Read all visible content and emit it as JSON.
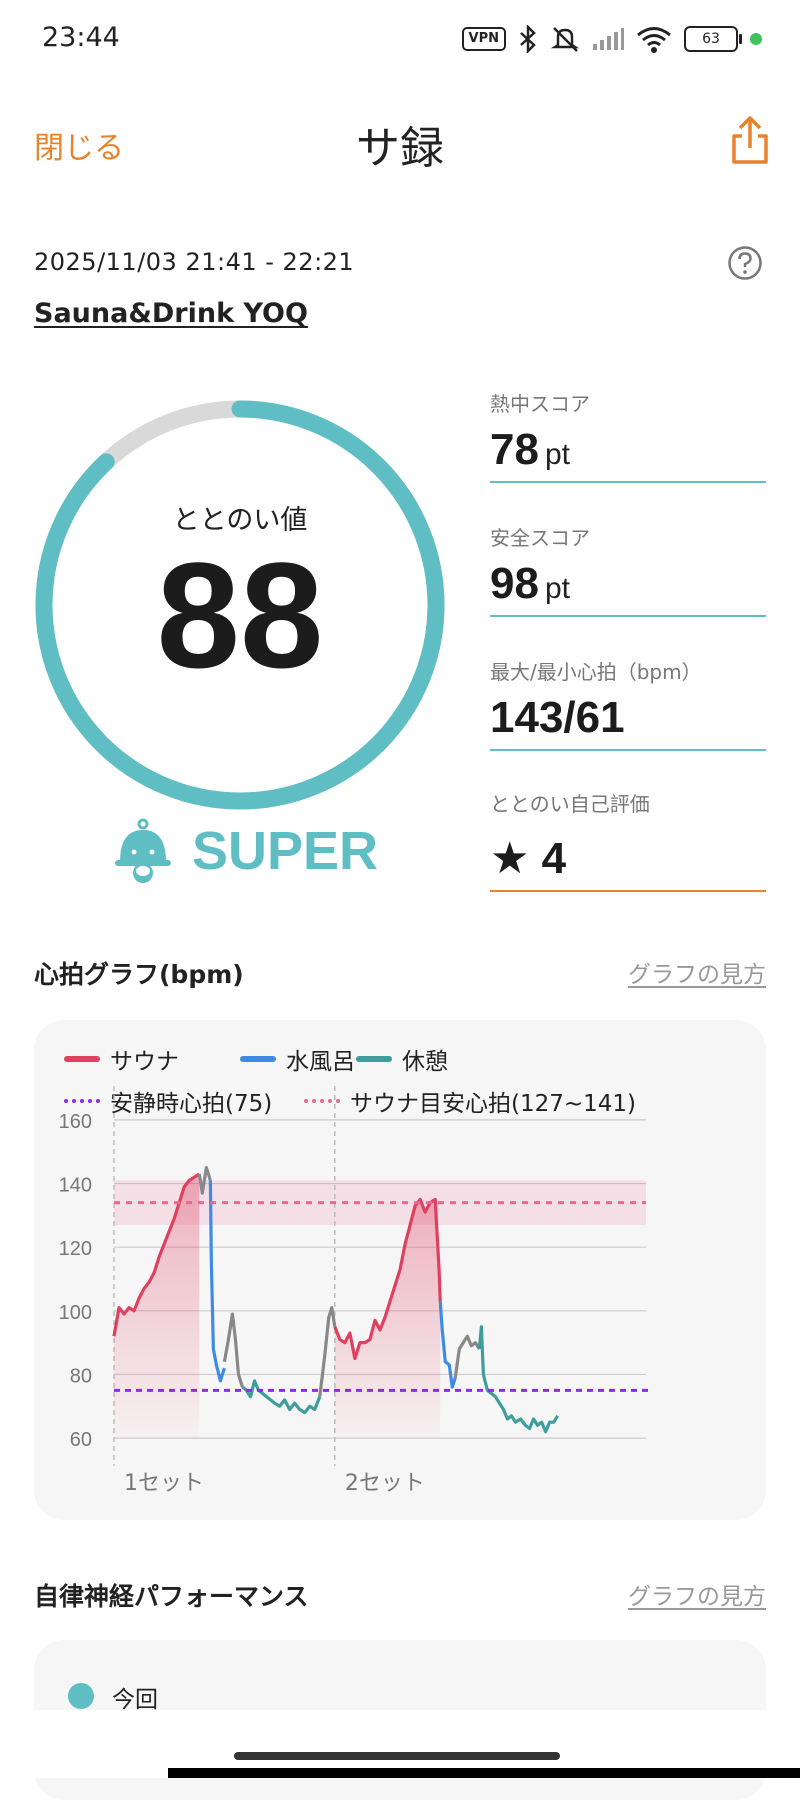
{
  "status_bar": {
    "time": "23:44",
    "vpn": "VPN",
    "battery": "63",
    "icons": [
      "vpn-icon",
      "bluetooth-icon",
      "mute-icon",
      "signal-icon",
      "wifi-icon",
      "battery-icon",
      "active-dot"
    ]
  },
  "header": {
    "close_label": "閉じる",
    "title": "サ録",
    "share_icon": "share-icon"
  },
  "session": {
    "time_range": "2025/11/03 21:41 - 22:21",
    "facility": "Sauna&Drink YOQ",
    "help_icon": "help-icon"
  },
  "score": {
    "label": "ととのい値",
    "value": "88",
    "progress": 0.88,
    "grade": "SUPER",
    "grade_icon": "bell-character-icon"
  },
  "metrics": [
    {
      "label": "熱中スコア",
      "value": "78",
      "unit": "pt"
    },
    {
      "label": "安全スコア",
      "value": "98",
      "unit": "pt"
    },
    {
      "label": "最大/最小心拍（bpm）",
      "value": "143/61",
      "unit": ""
    },
    {
      "label": "ととのい自己評価",
      "value": "★ 4",
      "unit": ""
    }
  ],
  "heart_section": {
    "title": "心拍グラフ(bpm)",
    "link": "グラフの見方"
  },
  "autonomic_section": {
    "title": "自律神経パフォーマンス",
    "link": "グラフの見方",
    "legend_label": "今回"
  },
  "colors": {
    "accent": "#5fbec3",
    "orange": "#e8822b",
    "sauna": "#e0405f",
    "water": "#3d8be6",
    "rest": "#3f9e9c",
    "resting_hr": "#8b2be2",
    "target_hr": "#e8698f",
    "transition": "#888888"
  },
  "chart_data": {
    "type": "line",
    "ylim": [
      55,
      165
    ],
    "yticks": [
      60,
      80,
      100,
      120,
      140,
      160
    ],
    "legend": [
      "サウナ",
      "水風呂",
      "休憩",
      "安静時心拍(75)",
      "サウナ目安心拍(127~141)"
    ],
    "resting_hr": 75,
    "target_band": [
      127,
      141
    ],
    "target_line": 134,
    "set_labels": [
      "1セット",
      "2セット"
    ],
    "set_starts": [
      0,
      220
    ],
    "x_max": 530,
    "series": [
      {
        "name": "サウナ",
        "segments": [
          [
            [
              0,
              92
            ],
            [
              5,
              101
            ],
            [
              10,
              99
            ],
            [
              15,
              101
            ],
            [
              20,
              100
            ],
            [
              25,
              104
            ],
            [
              30,
              107
            ],
            [
              35,
              109
            ],
            [
              40,
              112
            ],
            [
              45,
              117
            ],
            [
              50,
              121
            ],
            [
              55,
              125
            ],
            [
              60,
              129
            ],
            [
              65,
              134
            ],
            [
              70,
              139
            ],
            [
              75,
              141
            ],
            [
              80,
              142
            ],
            [
              85,
              143
            ]
          ]
        ]
      },
      {
        "name": "",
        "segments": [
          [
            [
              85,
              143
            ],
            [
              88,
              137
            ],
            [
              92,
              145
            ],
            [
              96,
              141
            ]
          ],
          [
            [
              110,
              84
            ],
            [
              114,
              91
            ],
            [
              118,
              99
            ],
            [
              121,
              91
            ],
            [
              124,
              80
            ],
            [
              128,
              76
            ]
          ],
          [
            [
              205,
              73
            ],
            [
              210,
              86
            ],
            [
              214,
              98
            ],
            [
              217,
              101
            ],
            [
              220,
              95
            ]
          ],
          [
            [
              340,
              79
            ],
            [
              344,
              88
            ],
            [
              348,
              90
            ],
            [
              352,
              92
            ],
            [
              356,
              89
            ],
            [
              360,
              90
            ],
            [
              364,
              88
            ]
          ]
        ]
      },
      {
        "name": "水風呂",
        "segments": [
          [
            [
              96,
              141
            ],
            [
              97,
              115
            ],
            [
              99,
              88
            ],
            [
              102,
              83
            ],
            [
              106,
              78
            ],
            [
              110,
              82
            ]
          ],
          [
            [
              325,
              103
            ],
            [
              327,
              94
            ],
            [
              330,
              84
            ],
            [
              334,
              83
            ],
            [
              337,
              76
            ],
            [
              340,
              79
            ]
          ]
        ]
      },
      {
        "name": "休憩",
        "segments": [
          [
            [
              128,
              76
            ],
            [
              132,
              75
            ],
            [
              136,
              73
            ],
            [
              140,
              78
            ],
            [
              144,
              75
            ],
            [
              148,
              74
            ],
            [
              152,
              73
            ],
            [
              156,
              72
            ],
            [
              160,
              71
            ],
            [
              165,
              70
            ],
            [
              170,
              72
            ],
            [
              175,
              69
            ],
            [
              180,
              71
            ],
            [
              185,
              69
            ],
            [
              190,
              68
            ],
            [
              195,
              70
            ],
            [
              200,
              69
            ],
            [
              205,
              73
            ]
          ],
          [
            [
              364,
              88
            ],
            [
              366,
              95
            ],
            [
              368,
              80
            ],
            [
              372,
              75
            ],
            [
              376,
              74
            ],
            [
              380,
              73
            ],
            [
              384,
              71
            ],
            [
              388,
              69
            ],
            [
              392,
              66
            ],
            [
              396,
              67
            ],
            [
              400,
              65
            ],
            [
              405,
              66
            ],
            [
              410,
              64
            ],
            [
              414,
              63
            ],
            [
              418,
              66
            ],
            [
              422,
              64
            ],
            [
              426,
              65
            ],
            [
              430,
              62
            ],
            [
              434,
              65
            ],
            [
              438,
              65
            ],
            [
              442,
              67
            ]
          ]
        ]
      },
      {
        "name": "サウナ",
        "segments": [
          [
            [
              220,
              95
            ],
            [
              225,
              91
            ],
            [
              230,
              90
            ],
            [
              235,
              93
            ],
            [
              240,
              85
            ],
            [
              245,
              90
            ],
            [
              250,
              90
            ],
            [
              255,
              91
            ],
            [
              260,
              97
            ],
            [
              265,
              94
            ],
            [
              270,
              98
            ],
            [
              275,
              103
            ],
            [
              280,
              108
            ],
            [
              285,
              113
            ],
            [
              290,
              121
            ],
            [
              295,
              127
            ],
            [
              300,
              133
            ],
            [
              305,
              135
            ],
            [
              310,
              131
            ],
            [
              315,
              134
            ],
            [
              320,
              135
            ],
            [
              324,
              112
            ],
            [
              325,
              103
            ]
          ]
        ]
      }
    ]
  }
}
